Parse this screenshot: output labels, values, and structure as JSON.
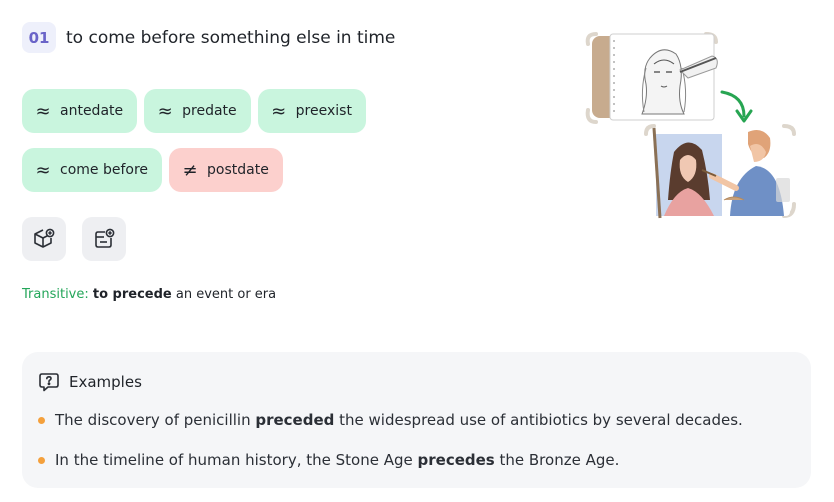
{
  "definition": {
    "number": "01",
    "text": "to come before something else in time"
  },
  "chips": {
    "synonyms": [
      "antedate",
      "predate",
      "preexist",
      "come before"
    ],
    "antonyms": [
      "postdate"
    ],
    "synonym_symbol": "≈",
    "antonym_symbol": "≠"
  },
  "tools": {
    "cube_icon": "cube-plus-icon",
    "card_icon": "card-add-icon"
  },
  "usage": {
    "tag": "Transitive:",
    "phrase": "to precede",
    "rest": " an event or era"
  },
  "examples": {
    "heading": "Examples",
    "items": [
      {
        "before": "The discovery of penicillin ",
        "bold": "preceded",
        "after": " the widespread use of antibiotics by several decades."
      },
      {
        "before": "In the timeline of human history, the Stone Age ",
        "bold": "precedes",
        "after": " the Bronze Age."
      }
    ]
  },
  "colors": {
    "synonym_bg": "#c9f5de",
    "antonym_bg": "#fcd0cd",
    "accent_purple": "#6a64c8",
    "usage_green": "#24a65a",
    "bullet_orange": "#f4a03c"
  }
}
